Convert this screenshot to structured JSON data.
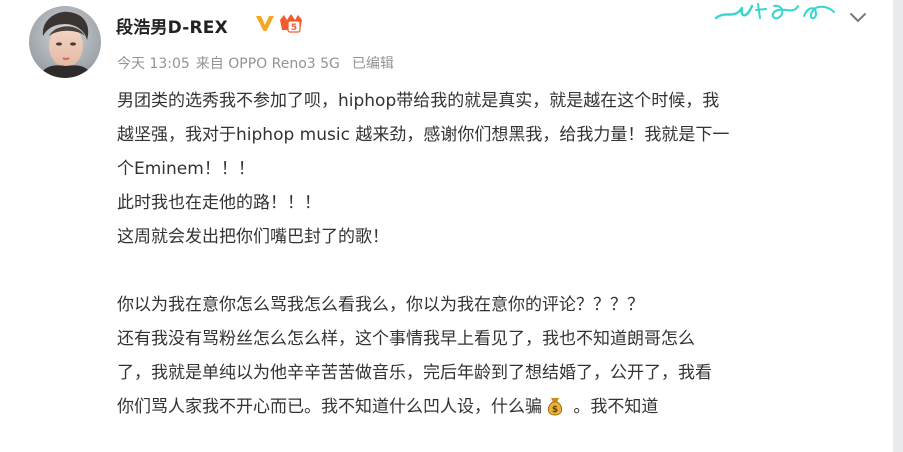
{
  "post": {
    "author": {
      "name": "段浩男D-REX",
      "avatar_icon": "avatar-portrait-icon",
      "verified_icon": "verified-v-icon",
      "member_icon": "member-level-icon",
      "member_level": "5"
    },
    "meta": {
      "time": "今天 13:05",
      "source": "来自 OPPO Reno3 5G",
      "edited": "已编辑"
    },
    "more_icon": "chevron-down-icon",
    "decoration_icon": "cyan-handwriting-decoration-icon",
    "content": {
      "paragraph1": [
        "男团类的选秀我不参加了呗，hiphop带给我的就是真实，就是越在这个时候，我",
        "越坚强，我对于hiphop music 越来劲，感谢你们想黑我，给我力量！我就是下一",
        "个Eminem！！！",
        "此时我也在走他的路！！！",
        "这周就会发出把你们嘴巴封了的歌！"
      ],
      "paragraph2": [
        "你以为我在意你怎么骂我怎么看我么，你以为我在意你的评论？？？？",
        "还有我没有骂粉丝怎么怎么样，这个事情我早上看见了，我也不知道朗哥怎么",
        "了，我就是单纯以为他辛辛苦苦做音乐，完后年龄到了想结婚了，公开了，我看"
      ],
      "last_line_before": "你们骂人家我不开心而已。我不知道什么凹人设，什么骗",
      "last_line_emoji_icon": "money-bag-icon",
      "last_line_after": " 。我不知道"
    },
    "colors": {
      "text": "#333333",
      "meta": "#939393",
      "verified": "#f6a623",
      "member": "#f45b2c",
      "accent_deco": "#35d6d0"
    }
  }
}
